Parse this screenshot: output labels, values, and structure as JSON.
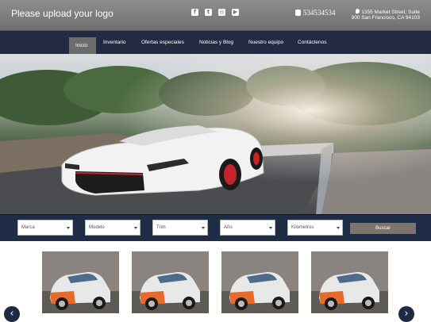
{
  "header": {
    "logo_text": "Please upload your logo",
    "social_icons": [
      "facebook-icon",
      "twitter-icon",
      "instagram-icon",
      "youtube-icon"
    ],
    "phone": "534534534",
    "address": "1355 Market Street, Suite 900 San Francisco, CA 94103"
  },
  "nav": {
    "items": [
      {
        "label": "Inicio",
        "active": true
      },
      {
        "label": "Inventario"
      },
      {
        "label": "Ofertas especiales"
      },
      {
        "label": "Noticias y Blog"
      },
      {
        "label": "Nuestro equipo"
      },
      {
        "label": "Contáctenos"
      }
    ]
  },
  "search": {
    "fields": [
      "Marca",
      "Modelo",
      "Trim",
      "Año",
      "Kilometros"
    ],
    "button": "Buscar"
  },
  "carousel": {
    "card_count": 4,
    "prev_icon": "chevron-left-icon",
    "next_icon": "chevron-right-icon"
  },
  "colors": {
    "topbar": "#7f7f7f",
    "navbar": "#232b42",
    "search_bar": "#1f2c46",
    "search_button": "#7d7470",
    "active_tab": "#6c6c6c"
  }
}
